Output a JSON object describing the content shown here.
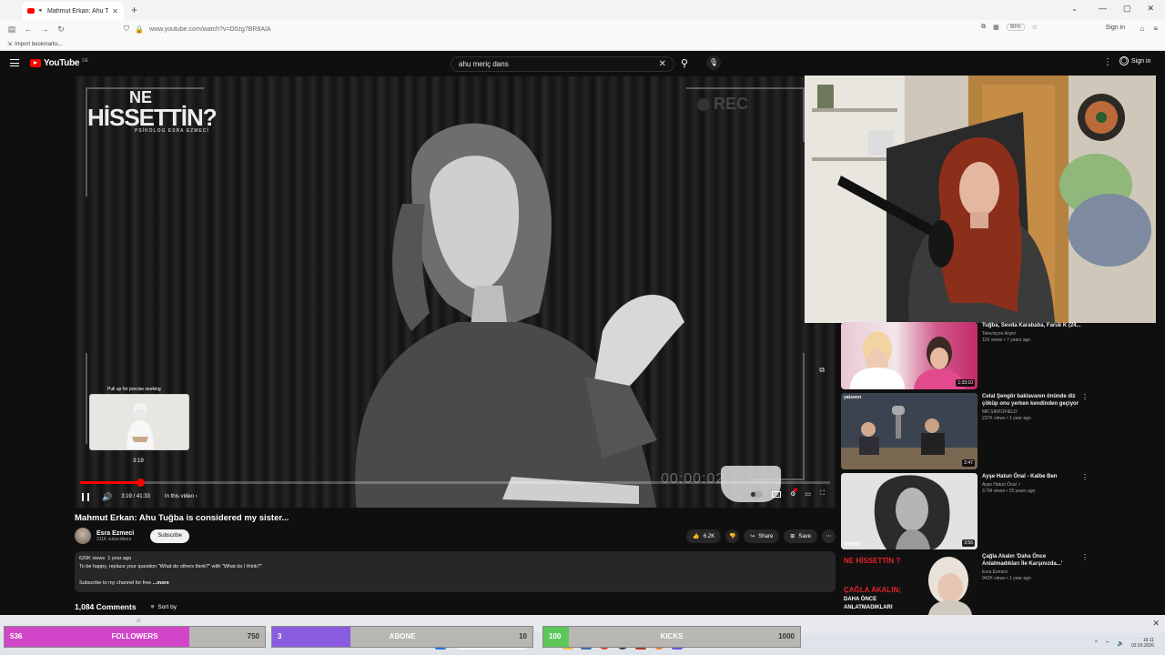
{
  "browser": {
    "tab_title": "Mahmut Erkan: Ahu Tuğba",
    "url": "www.youtube.com/watch?v=D0zg7BR8AIA",
    "zoom": "90%",
    "sign_in": "Sign in",
    "bookmark": "Import bookmarks..."
  },
  "youtube": {
    "logo": "YouTube",
    "region": "DE",
    "search_query": "ahu meriç dans",
    "sign_in": "Sign in"
  },
  "player": {
    "overlay_title_line1": "NE",
    "overlay_title_line2": "HİSSETTİN?",
    "overlay_subtitle": "PSİKOLOG ESRA EZMECİ",
    "rec_label": "REC",
    "timecode": "00:00:02",
    "pull_hint": "Pull up for precise seeking",
    "preview_time": "3:19",
    "time_display": "3:19 / 41:33",
    "chapter": "In this video",
    "progress_fraction": 0.08
  },
  "video": {
    "title": "Mahmut Erkan: Ahu Tuğba is considered my sister...",
    "channel": "Esra Ezmeci",
    "subscribers": "311K subscribers",
    "subscribe": "Subscribe",
    "likes": "6.2K",
    "share": "Share",
    "save": "Save",
    "views": "620K views",
    "age": "1 year ago",
    "description_line1": "To be happy, replace your question \"What do others think?\" with \"What do I think?\"",
    "description_line2": "Subscribe to my channel for free",
    "more": "...more",
    "comments_count": "1,084 Comments",
    "sort_by": "Sort by"
  },
  "recommended": [
    {
      "title": "Tuğba, Sevda Karababa, Faruk K (24...",
      "channel": "Televizyon Arşivi",
      "meta": "11K views • 7 years ago",
      "duration": "1:33:10"
    },
    {
      "title": "Celal Şengör baklavanın önünde diz çöküp onu yerken kendinden geçiyor",
      "channel": "MR.SIKKOFIELD",
      "meta": "237K views • 1 year ago",
      "duration": "2:47"
    },
    {
      "title": "Ayşe Hatun Önal - Kalbe Ben",
      "channel": "Ayşe Hatun Önal",
      "meta": "3.7M views • 15 years ago",
      "duration": "3:56"
    },
    {
      "title": "Çağla Akalın 'Daha Önce Anlatmadıkları İle Karşınızda...'",
      "channel": "Esra Ezmeci",
      "meta": "942K views • 1 year ago",
      "duration": ""
    }
  ],
  "thumb_texts": {
    "second": "yatsoon",
    "third": "vevo",
    "fourth_top": "NE HİSSETTİN ?",
    "fourth_bottom": "ÇAĞLA AKALIN;",
    "fourth_bottom2": "DAHA ÖNCE",
    "fourth_bottom3": "ANLATMADIKLARI"
  },
  "goals": [
    {
      "current": "536",
      "label": "FOLLOWERS",
      "max": "750",
      "fraction": 0.71,
      "color": "#d146c8"
    },
    {
      "current": "3",
      "label": "ABONE",
      "max": "10",
      "fraction": 0.3,
      "color": "#8a5ce0"
    },
    {
      "current": "100",
      "label": "KICKS",
      "max": "1000",
      "fraction": 0.1,
      "color": "#5cc85a"
    }
  ],
  "taskbar": {
    "search": "Suche",
    "time": "16:11",
    "date": "02.03.2026"
  },
  "colors": {
    "youtube_red": "#ff0000",
    "page_bg": "#0f0f0f"
  }
}
